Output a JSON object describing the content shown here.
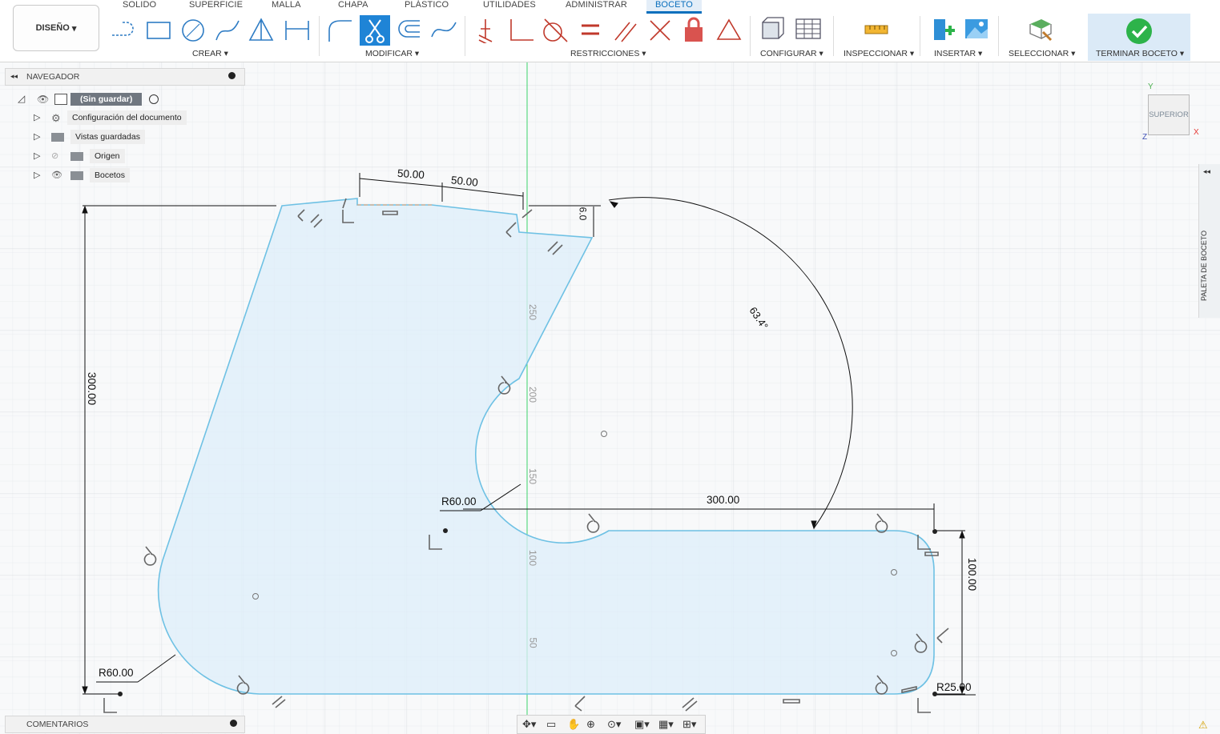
{
  "workspace": {
    "label": "DISEÑO"
  },
  "tabs": [
    {
      "label": "SOLIDO",
      "active": false
    },
    {
      "label": "SUPERFICIE",
      "active": false
    },
    {
      "label": "MALLA",
      "active": false
    },
    {
      "label": "CHAPA",
      "active": false
    },
    {
      "label": "PLÁSTICO",
      "active": false
    },
    {
      "label": "UTILIDADES",
      "active": false
    },
    {
      "label": "ADMINISTRAR",
      "active": false
    },
    {
      "label": "BOCETO",
      "active": true
    }
  ],
  "groups": [
    {
      "label": "CREAR ▾"
    },
    {
      "label": "MODIFICAR ▾"
    },
    {
      "label": "RESTRICCIONES ▾"
    },
    {
      "label": "CONFIGURAR ▾"
    },
    {
      "label": "INSPECCIONAR ▾"
    },
    {
      "label": "INSERTAR ▾"
    },
    {
      "label": "SELECCIONAR ▾"
    },
    {
      "label": "TERMINAR BOCETO ▾"
    }
  ],
  "colors": {
    "accent": "#0a6fbd",
    "sketch_line": "#6ec1e4",
    "profile_fill": "#deedf9",
    "constraint": "#c0392b",
    "finish": "#2db34a",
    "axis_green": "#3dd36b"
  },
  "navigator": {
    "title": "NAVEGADOR",
    "root": "(Sin guardar)",
    "items": [
      {
        "label": "Configuración del documento",
        "icon": "gear-icon"
      },
      {
        "label": "Vistas guardadas",
        "icon": "folder-icon"
      },
      {
        "label": "Origen",
        "icon": "folder-icon"
      },
      {
        "label": "Bocetos",
        "icon": "folder-icon"
      }
    ]
  },
  "comments": {
    "label": "COMENTARIOS"
  },
  "viewcube": {
    "face": "SUPERIOR",
    "axis_y": "Y",
    "axis_x": "X",
    "axis_z": "Z"
  },
  "palette": {
    "label": "PALETA DE BOCETO"
  },
  "dimensions": {
    "top_left": "50.00",
    "top_right": "50.00",
    "small_right": "6.0",
    "angle": "63.4°",
    "height": "300.00",
    "width_lower": "300.00",
    "height_lower": "100.00",
    "radius_inner": "R60.00",
    "radius_bottom_left": "R60.00",
    "radius_corner": "R25.00"
  },
  "axis_ticks": [
    "250",
    "200",
    "150",
    "100",
    "50"
  ]
}
